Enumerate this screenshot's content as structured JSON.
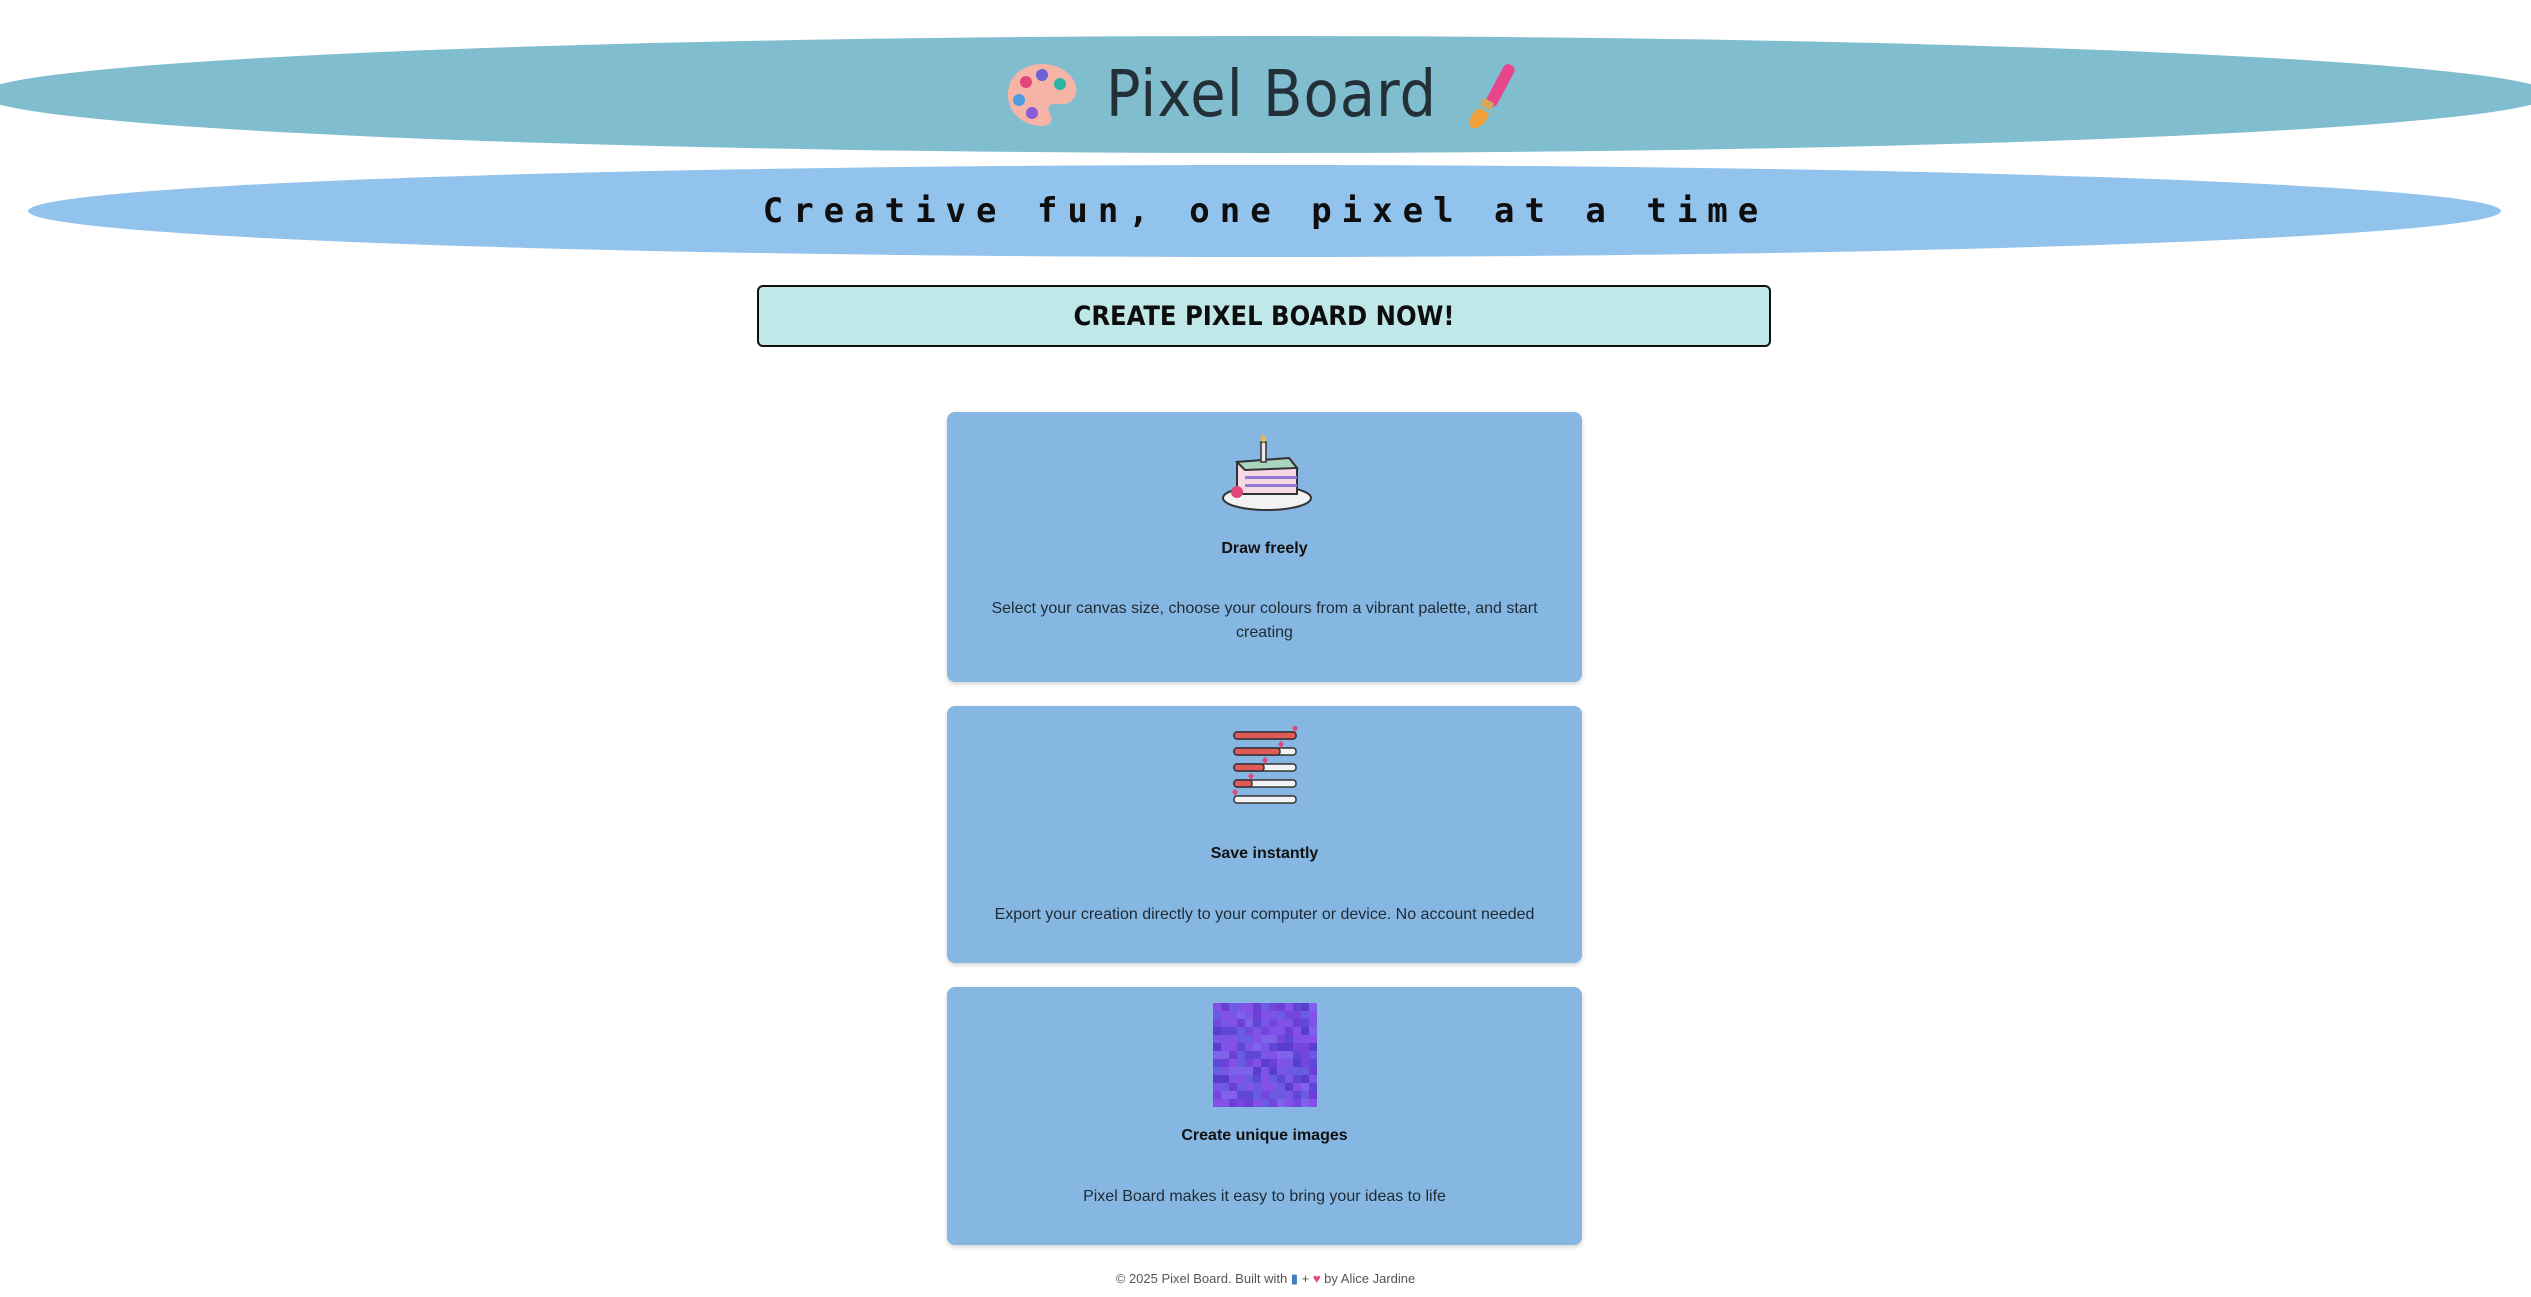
{
  "header": {
    "title": "Pixel Board",
    "left_icon": "palette-icon",
    "right_icon": "paintbrush-icon"
  },
  "subtitle": "Creative fun, one pixel at a time",
  "cta": {
    "label": "CREATE PIXEL BOARD NOW!"
  },
  "features": [
    {
      "icon": "cake-slice-icon",
      "title": "Draw freely",
      "desc": "Select your canvas size, choose your colours from a vibrant palette, and start creating"
    },
    {
      "icon": "hearts-levels-icon",
      "title": "Save instantly",
      "desc": "Export your creation directly to your computer or device. No account needed"
    },
    {
      "icon": "pixel-grid-icon",
      "title": "Create unique images",
      "desc": "Pixel Board makes it easy to bring your ideas to life"
    }
  ],
  "footer": {
    "prefix": "© 2025 Pixel Board. Built with",
    "book_glyph": "▮",
    "plus": "+",
    "heart_glyph": "♥",
    "suffix": "by Alice Jardine"
  },
  "colors": {
    "header_bg": "#7fbdcf",
    "subtitle_bg": "#92c3ec",
    "cta_bg": "#c0e8e8",
    "card_bg": "#86b7e2"
  }
}
